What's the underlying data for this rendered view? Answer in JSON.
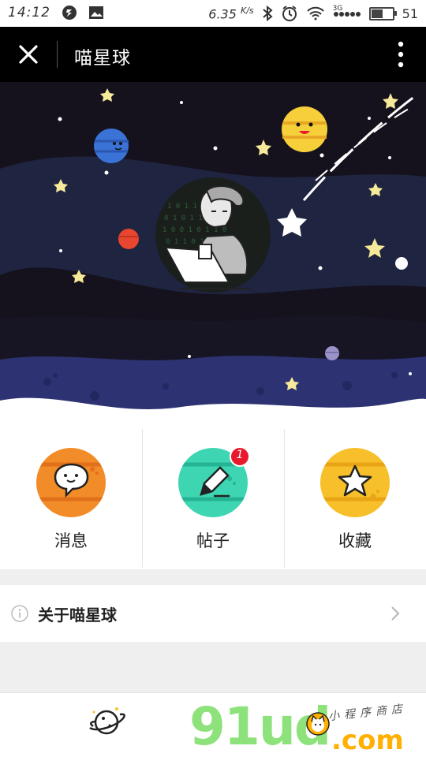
{
  "status_bar": {
    "time": "14:12",
    "net_speed": "6.35",
    "net_speed_unit": "K/s",
    "signal_label": "3G",
    "battery_level": "51",
    "battery_fraction": 0.51
  },
  "header": {
    "title": "喵星球",
    "close_icon": "close-icon",
    "more_icon": "more-vertical-icon"
  },
  "menu": [
    {
      "label": "消息",
      "icon": "chat-bubble-icon",
      "planet_color": "#f28c28",
      "badge": null
    },
    {
      "label": "帖子",
      "icon": "pencil-icon",
      "planet_color": "#3ed6b2",
      "badge": "1"
    },
    {
      "label": "收藏",
      "icon": "star-icon",
      "planet_color": "#f7bf2a",
      "badge": null
    }
  ],
  "about": {
    "label": "关于喵星球",
    "icon": "info-icon",
    "chevron_icon": "chevron-right-icon"
  },
  "tab_bar": {
    "planet_tab_icon": "planet-icon"
  },
  "watermark": {
    "brand": "91ud",
    "suffix": ".com",
    "tagline": "小程序商店"
  },
  "colors": {
    "hero_bg": "#15121d",
    "badge_red": "#e8192c",
    "watermark_green": "#8de27c",
    "watermark_orange": "#ffb000"
  }
}
